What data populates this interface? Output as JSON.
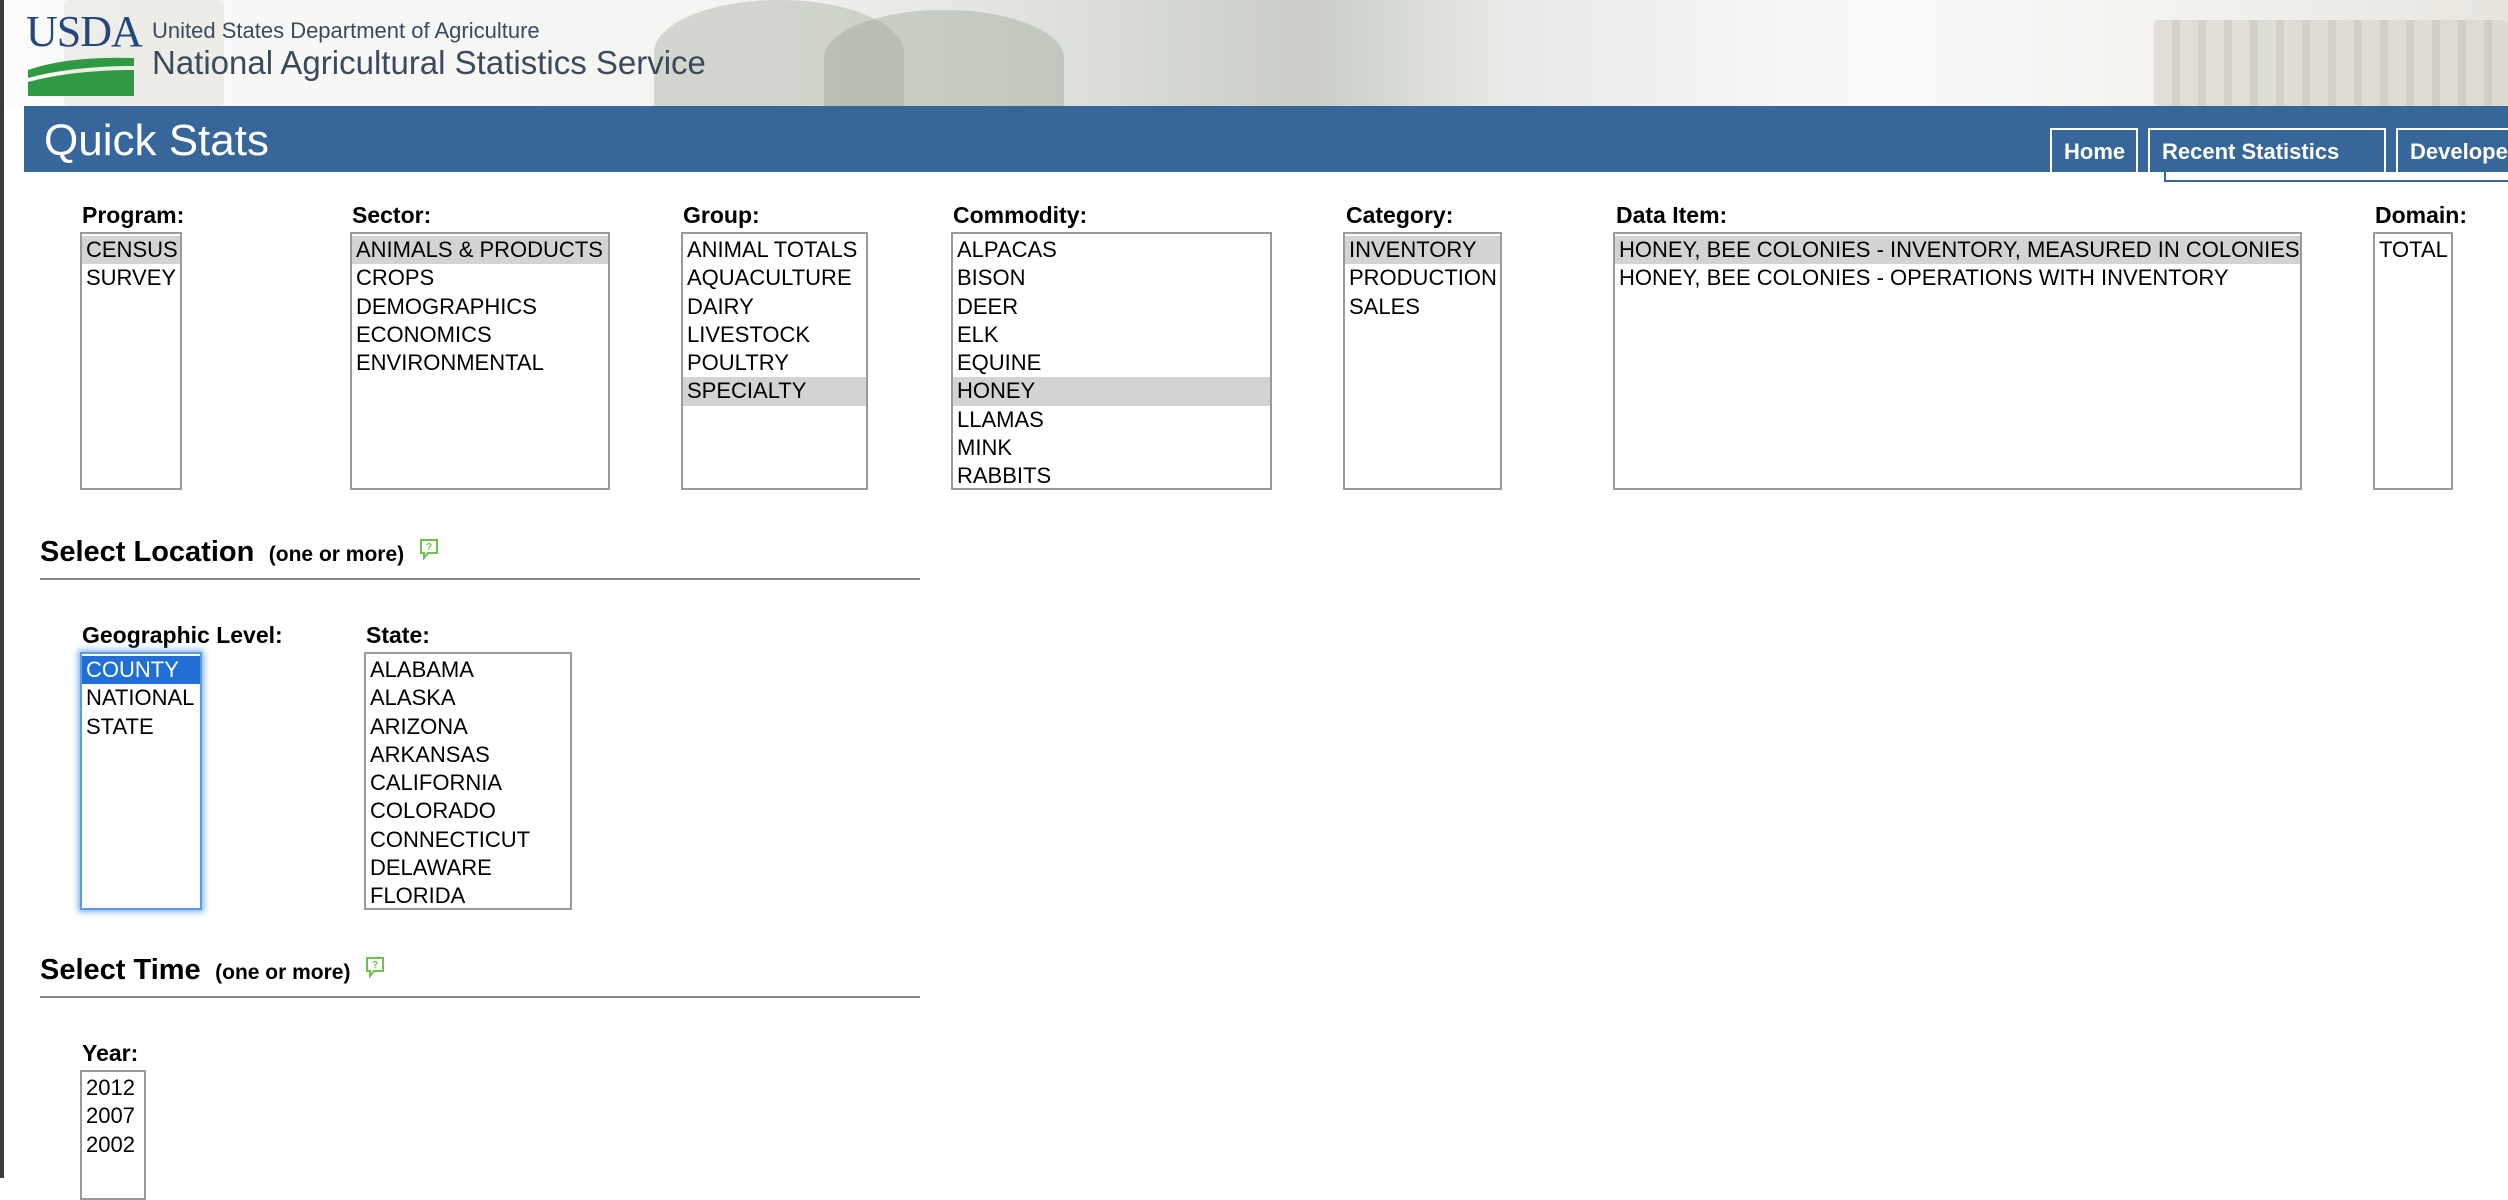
{
  "header": {
    "logo_text": "USDA",
    "department": "United States Department of Agriculture",
    "agency": "National Agricultural Statistics Service"
  },
  "title_bar": {
    "title": "Quick Stats",
    "tabs": [
      "Home",
      "Recent Statistics",
      "Developers"
    ]
  },
  "filters": {
    "program": {
      "label": "Program:",
      "options": [
        "CENSUS",
        "SURVEY"
      ],
      "selected": "CENSUS"
    },
    "sector": {
      "label": "Sector:",
      "options": [
        "ANIMALS & PRODUCTS",
        "CROPS",
        "DEMOGRAPHICS",
        "ECONOMICS",
        "ENVIRONMENTAL"
      ],
      "selected": "ANIMALS & PRODUCTS"
    },
    "group": {
      "label": "Group:",
      "options": [
        "ANIMAL TOTALS",
        "AQUACULTURE",
        "DAIRY",
        "LIVESTOCK",
        "POULTRY",
        "SPECIALTY"
      ],
      "selected": "SPECIALTY"
    },
    "commodity": {
      "label": "Commodity:",
      "options": [
        "ALPACAS",
        "BISON",
        "DEER",
        "ELK",
        "EQUINE",
        "HONEY",
        "LLAMAS",
        "MINK",
        "RABBITS"
      ],
      "selected": "HONEY"
    },
    "category": {
      "label": "Category:",
      "options": [
        "INVENTORY",
        "PRODUCTION",
        "SALES"
      ],
      "selected": "INVENTORY"
    },
    "data_item": {
      "label": "Data Item:",
      "options": [
        "HONEY, BEE COLONIES - INVENTORY, MEASURED IN COLONIES",
        "HONEY, BEE COLONIES - OPERATIONS WITH INVENTORY"
      ],
      "selected": "HONEY, BEE COLONIES - INVENTORY, MEASURED IN COLONIES"
    },
    "domain": {
      "label": "Domain:",
      "options": [
        "TOTAL"
      ],
      "selected": ""
    }
  },
  "location": {
    "heading": "Select Location",
    "note": "(one or more)",
    "geo_level": {
      "label": "Geographic Level:",
      "options": [
        "COUNTY",
        "NATIONAL",
        "STATE"
      ],
      "selected": "COUNTY"
    },
    "state": {
      "label": "State:",
      "options": [
        "ALABAMA",
        "ALASKA",
        "ARIZONA",
        "ARKANSAS",
        "CALIFORNIA",
        "COLORADO",
        "CONNECTICUT",
        "DELAWARE",
        "FLORIDA"
      ],
      "selected": ""
    }
  },
  "time": {
    "heading": "Select Time",
    "note": "(one or more)",
    "year": {
      "label": "Year:",
      "options": [
        "2012",
        "2007",
        "2002"
      ],
      "selected": ""
    }
  },
  "colors": {
    "title_bar": "#37679a",
    "selected_option": "#d3d3d3",
    "focused_selection": "#1f6fd6",
    "help_icon": "#6cc24a"
  },
  "icons": {
    "help": "help-bubble-icon"
  }
}
